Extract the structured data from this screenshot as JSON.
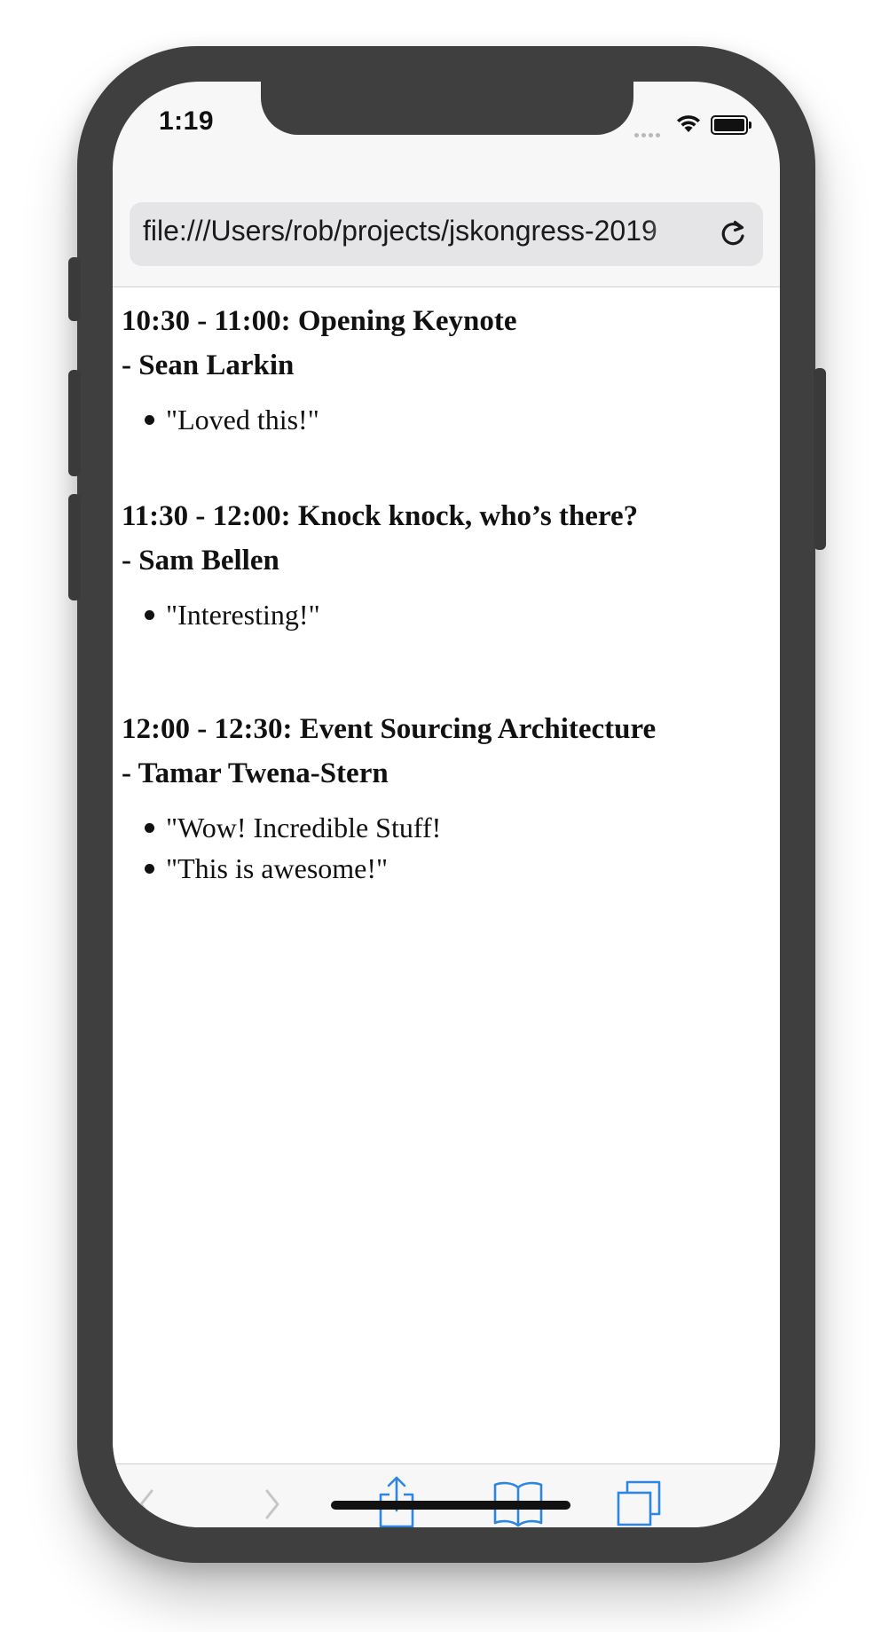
{
  "status_bar": {
    "time": "1:19"
  },
  "browser": {
    "url": "file:///Users/rob/projects/jskongress-2019"
  },
  "talks": [
    {
      "title": "10:30 - 11:00: Opening Keynote",
      "speaker": "- Sean Larkin",
      "comments": [
        "\"Loved this!\""
      ]
    },
    {
      "title": "11:30 - 12:00: Knock knock, who’s there?",
      "speaker": "- Sam Bellen",
      "comments": [
        "\"Interesting!\""
      ]
    },
    {
      "title": "12:00 - 12:30: Event Sourcing Architecture",
      "speaker": "- Tamar Twena-Stern",
      "comments": [
        "\"Wow! Incredible Stuff!",
        "\"This is awesome!\""
      ]
    }
  ],
  "toolbar": {
    "icons": [
      "back-icon",
      "forward-icon",
      "share-icon",
      "bookmarks-icon",
      "tabs-icon"
    ],
    "accent": "#2f86e0",
    "disabled": "#c5c5c9"
  }
}
